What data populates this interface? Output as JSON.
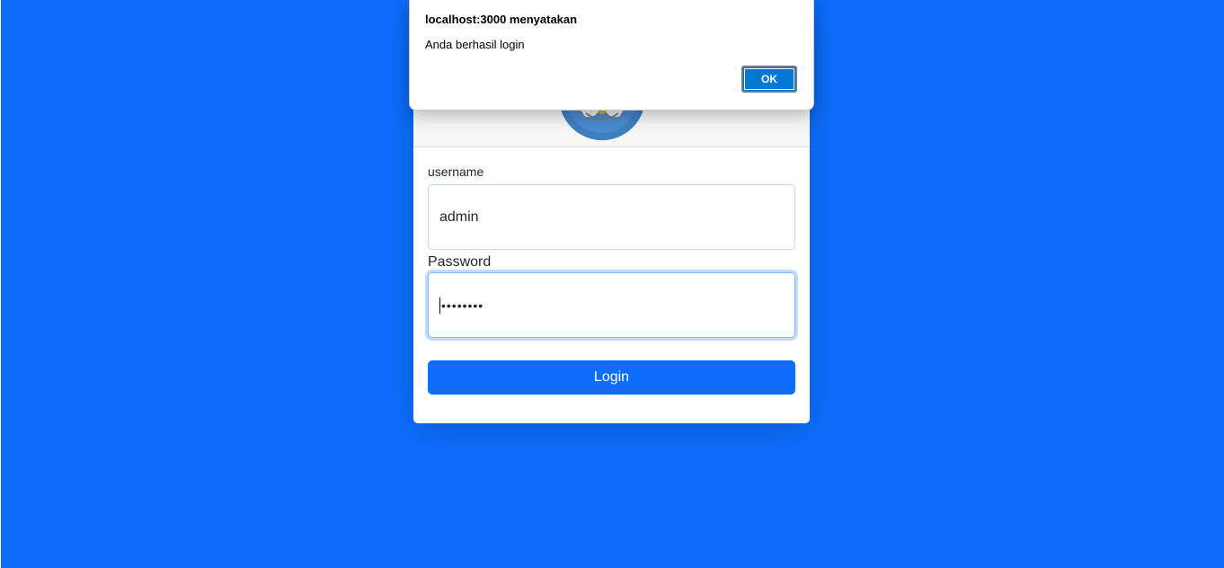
{
  "form": {
    "username_label": "username",
    "username_value": "admin",
    "password_label": "Password",
    "password_masked": "••••••••",
    "login_label": "Login"
  },
  "dialog": {
    "title": "localhost:3000 menyatakan",
    "message": "Anda berhasil login",
    "ok_label": "OK"
  },
  "colors": {
    "background": "#0d6efd",
    "primary_button": "#0d6efd",
    "dialog_ok": "#0078d4"
  },
  "icons": {
    "logo": "tut-wuri-handayani-logo"
  }
}
